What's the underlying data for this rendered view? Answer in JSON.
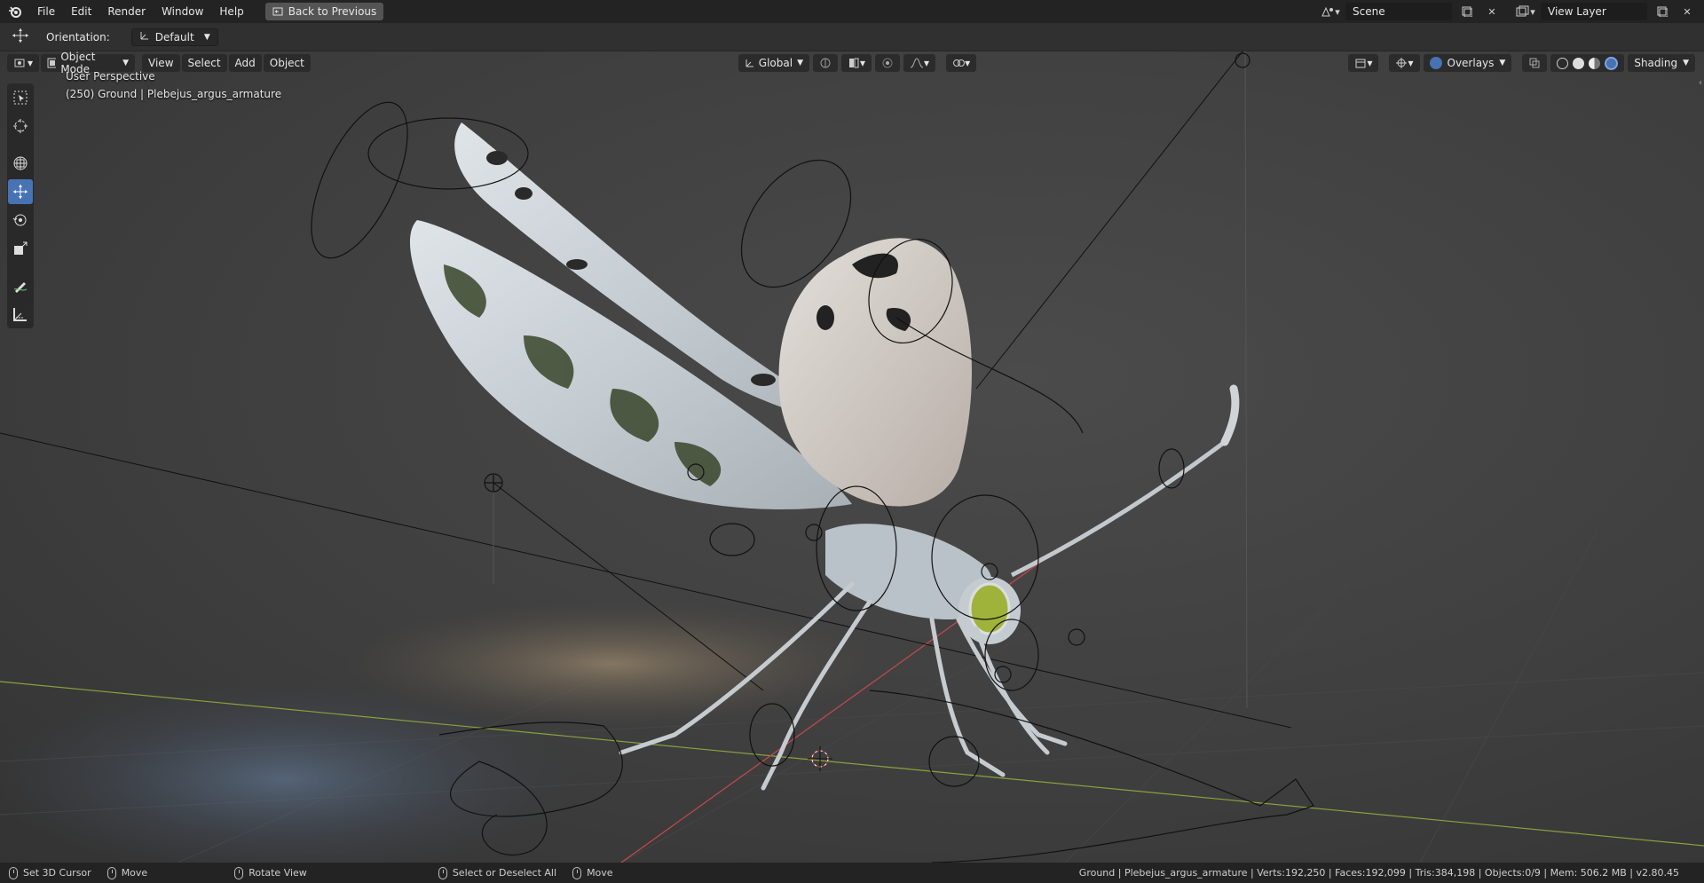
{
  "app": {
    "name": "Blender"
  },
  "menubar": {
    "items": [
      "File",
      "Edit",
      "Render",
      "Window",
      "Help"
    ],
    "back_button": "Back to Previous"
  },
  "topright": {
    "scene_label": "Scene",
    "view_layer_label": "View Layer"
  },
  "tool_settings": {
    "orientation_label": "Orientation:",
    "orientation_value": "Default"
  },
  "viewport_header": {
    "mode": "Object Mode",
    "menus": [
      "View",
      "Select",
      "Add",
      "Object"
    ],
    "transform_orientation": "Global",
    "overlays_label": "Overlays",
    "shading_label": "Shading"
  },
  "viewport": {
    "perspective_label": "User Perspective",
    "object_info": "(250) Ground | Plebejus_argus_armature"
  },
  "statusbar": {
    "items": [
      "Set 3D Cursor",
      "Move",
      "Rotate View",
      "Select or Deselect All",
      "Move"
    ],
    "stats": "Ground | Plebejus_argus_armature | Verts:192,250 | Faces:192,099 | Tris:384,198 | Objects:0/9 | Mem: 506.2 MB | v2.80.45"
  },
  "colors": {
    "active_tool": "#4772b3",
    "x_axis": "#c8484f",
    "y_axis": "#8aa23c"
  }
}
